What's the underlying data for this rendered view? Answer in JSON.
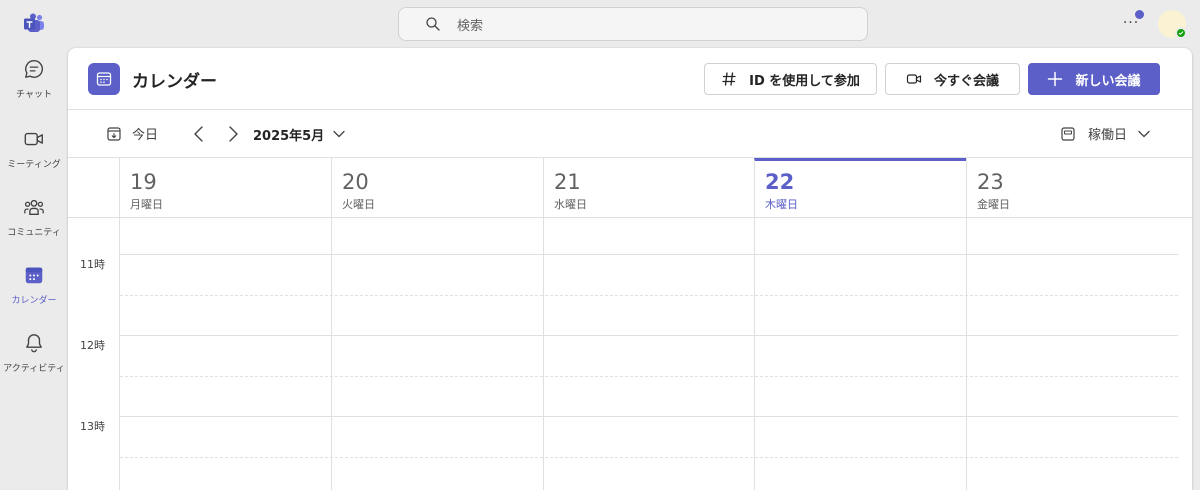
{
  "search": {
    "placeholder": "検索"
  },
  "header_bar": {
    "more_label": "···"
  },
  "colors": {
    "accent": "#5b5fc7",
    "presence": "#13a10e",
    "avatar_bg": "#fbf2d3",
    "border": "#e0e0e0"
  },
  "rail": {
    "items": [
      {
        "label": "チャット",
        "icon": "chat-icon"
      },
      {
        "label": "ミーティング",
        "icon": "video-icon"
      },
      {
        "label": "コミュニティ",
        "icon": "people-icon"
      },
      {
        "label": "カレンダー",
        "icon": "calendar-icon",
        "active": true
      },
      {
        "label": "アクティビティ",
        "icon": "bell-icon"
      }
    ]
  },
  "page": {
    "title": "カレンダー",
    "join_button": "ID を使用して参加",
    "meet_now_button": "今すぐ会議",
    "new_meeting_button": "新しい会議"
  },
  "toolbar": {
    "today_label": "今日",
    "month_label": "2025年5月",
    "view_label": "稼働日"
  },
  "days": [
    {
      "num": "19",
      "name": "月曜日"
    },
    {
      "num": "20",
      "name": "火曜日"
    },
    {
      "num": "21",
      "name": "水曜日"
    },
    {
      "num": "22",
      "name": "木曜日",
      "today": true
    },
    {
      "num": "23",
      "name": "金曜日"
    }
  ],
  "time_labels": [
    "11時",
    "12時",
    "13時"
  ]
}
